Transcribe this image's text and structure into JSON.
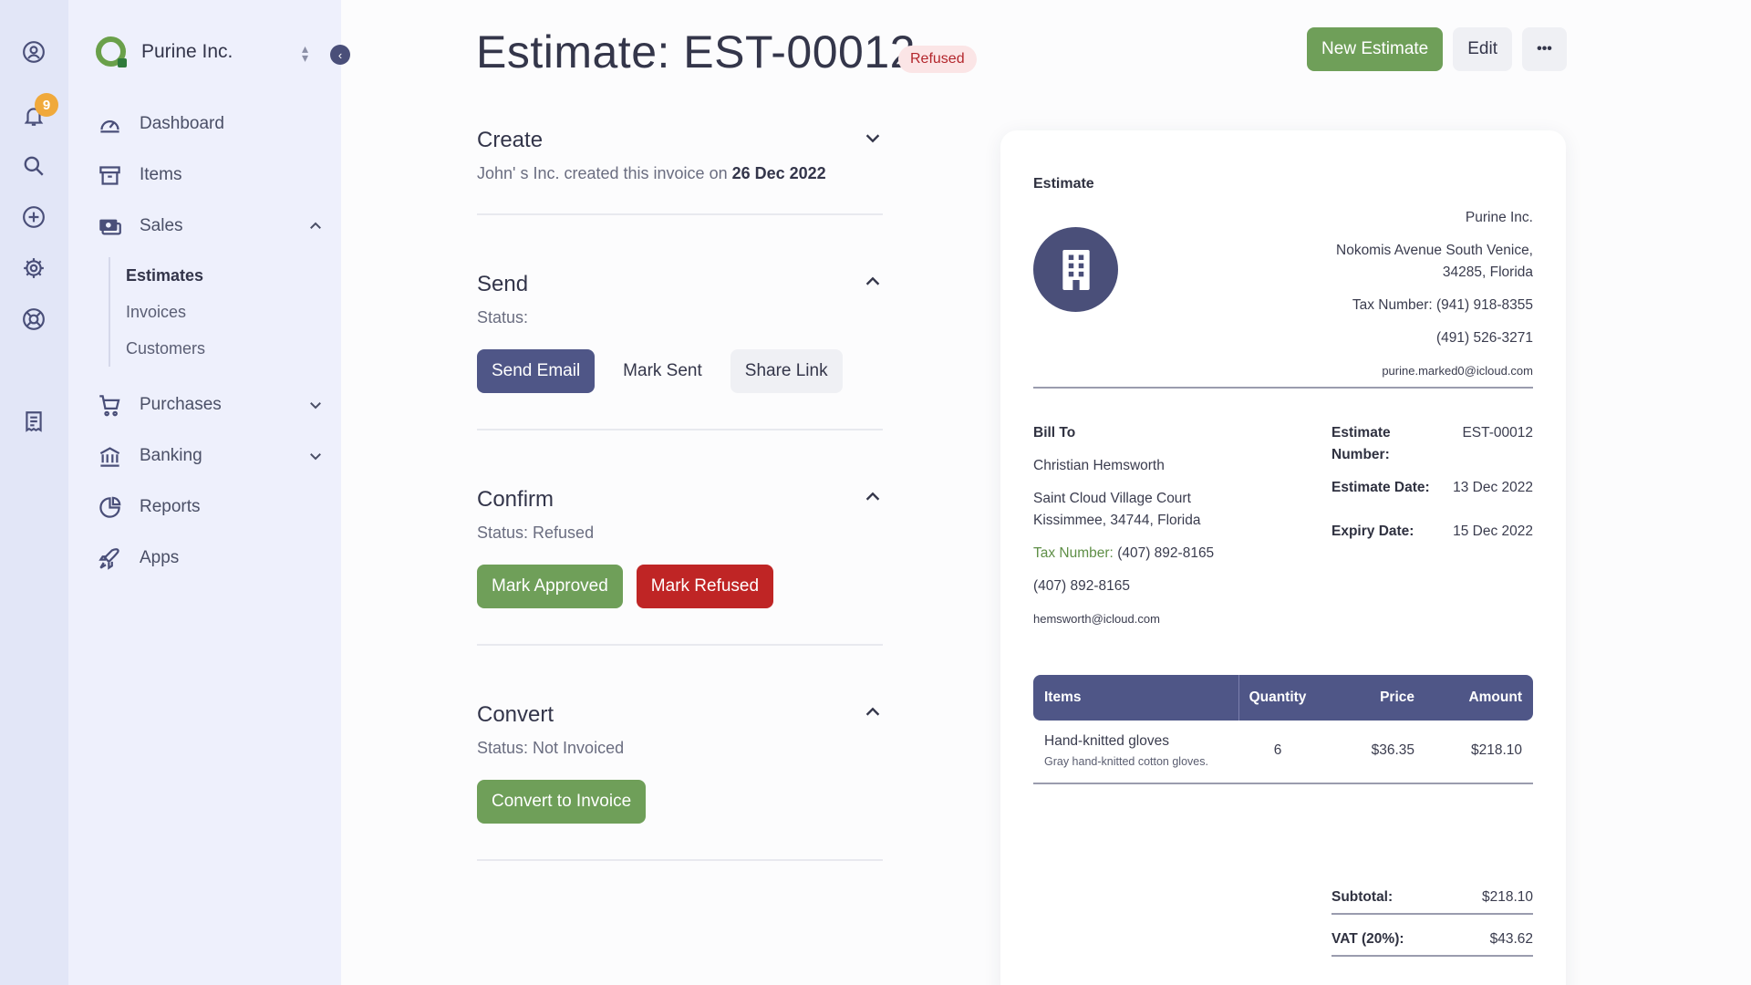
{
  "rail": {
    "notification_count": "9",
    "icons": [
      "profile-icon",
      "bell-icon",
      "search-icon",
      "plus-circle-icon",
      "gear-icon",
      "lifebuoy-icon",
      "receipt-icon"
    ]
  },
  "sidebar": {
    "company": "Purine Inc.",
    "items": [
      {
        "label": "Dashboard",
        "icon": "dashboard-icon"
      },
      {
        "label": "Items",
        "icon": "archive-icon"
      },
      {
        "label": "Sales",
        "icon": "money-icon"
      },
      {
        "label": "Purchases",
        "icon": "cart-icon"
      },
      {
        "label": "Banking",
        "icon": "bank-icon"
      },
      {
        "label": "Reports",
        "icon": "pie-icon"
      },
      {
        "label": "Apps",
        "icon": "rocket-icon"
      }
    ],
    "sales_sub": [
      "Estimates",
      "Invoices",
      "Customers"
    ]
  },
  "header": {
    "title": "Estimate: EST-00012",
    "status": "Refused",
    "new_label": "New Estimate",
    "edit_label": "Edit",
    "more_label": "•••"
  },
  "steps": {
    "create": {
      "title": "Create",
      "text": "John' s Inc. created this invoice on",
      "date": "26 Dec 2022"
    },
    "send": {
      "title": "Send",
      "status": "Status:",
      "buttons": [
        "Send Email",
        "Mark Sent",
        "Share Link"
      ]
    },
    "confirm": {
      "title": "Confirm",
      "status": "Status: Refused",
      "buttons": [
        "Mark Approved",
        "Mark Refused"
      ]
    },
    "convert": {
      "title": "Convert",
      "status": "Status: Not Invoiced",
      "button": "Convert to Invoice"
    }
  },
  "preview": {
    "label": "Estimate",
    "company": {
      "name": "Purine Inc.",
      "address1": "Nokomis Avenue South Venice,",
      "address2": "34285, Florida",
      "tax": "Tax Number: (941) 918-8355",
      "phone": "(491) 526-3271",
      "email": "purine.marked0@icloud.com"
    },
    "bill_to": {
      "heading": "Bill To",
      "name": "Christian Hemsworth",
      "address1": "Saint Cloud Village Court",
      "address2": "Kissimmee, 34744, Florida",
      "tax_label": "Tax Number:",
      "tax_value": "(407) 892-8165",
      "phone": "(407) 892-8165",
      "email": "hemsworth@icloud.com"
    },
    "meta": {
      "number_label": "Estimate Number:",
      "number": "EST-00012",
      "date_label": "Estimate Date:",
      "date": "13 Dec 2022",
      "expiry_label": "Expiry Date:",
      "expiry": "15 Dec 2022"
    },
    "table": {
      "headers": [
        "Items",
        "Quantity",
        "Price",
        "Amount"
      ],
      "rows": [
        {
          "name": "Hand-knitted gloves",
          "desc": "Gray hand-knitted cotton gloves.",
          "qty": "6",
          "price": "$36.35",
          "amount": "$218.10"
        }
      ]
    },
    "totals": {
      "subtotal_label": "Subtotal:",
      "subtotal": "$218.10",
      "vat_label": "VAT (20%):",
      "vat": "$43.62"
    }
  }
}
